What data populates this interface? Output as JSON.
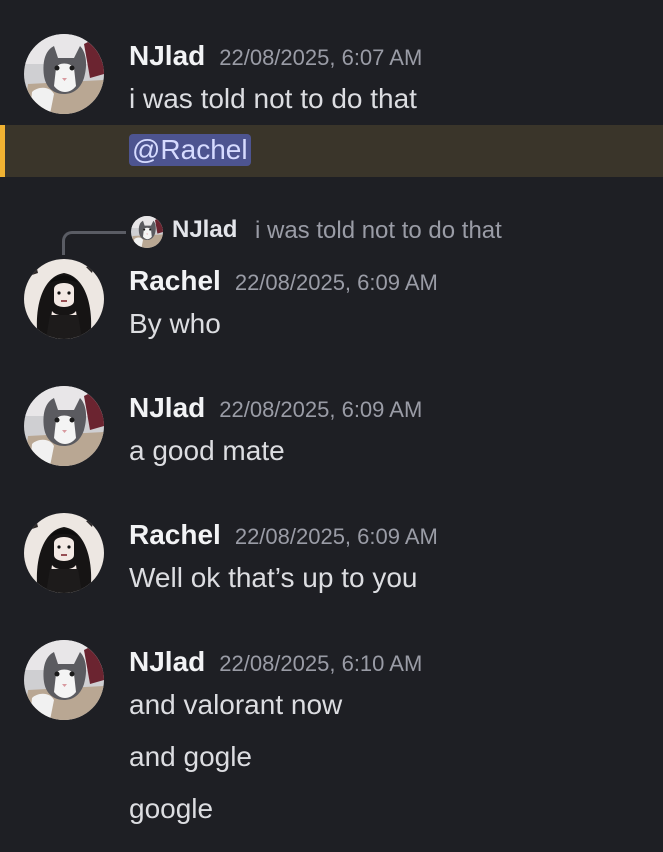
{
  "messages": [
    {
      "author": "NJlad",
      "timestamp": "22/08/2025, 6:07 AM",
      "lines": [
        "i was told not to do that"
      ],
      "mention": "@Rachel",
      "avatar_icon": "cat-avatar-icon"
    },
    {
      "author": "Rachel",
      "timestamp": "22/08/2025, 6:09 AM",
      "reply_to": {
        "author": "NJlad",
        "text": "i was told not to do that"
      },
      "lines": [
        "By who"
      ],
      "avatar_icon": "gothic-girl-avatar-icon"
    },
    {
      "author": "NJlad",
      "timestamp": "22/08/2025, 6:09 AM",
      "lines": [
        "a good mate"
      ],
      "avatar_icon": "cat-avatar-icon"
    },
    {
      "author": "Rachel",
      "timestamp": "22/08/2025, 6:09 AM",
      "lines": [
        "Well ok that’s up to you"
      ],
      "avatar_icon": "gothic-girl-avatar-icon"
    },
    {
      "author": "NJlad",
      "timestamp": "22/08/2025, 6:10 AM",
      "lines": [
        "and valorant now",
        "and gogle",
        "google"
      ],
      "avatar_icon": "cat-avatar-icon"
    }
  ],
  "colors": {
    "background": "#1e1f24",
    "mention_highlight_bg": "#3a352a",
    "mention_highlight_bar": "#f0b232",
    "mention_pill": "#4d5490",
    "username": "#f2f3f5",
    "timestamp": "#9a9ca6",
    "message_text": "#dcdde1"
  }
}
